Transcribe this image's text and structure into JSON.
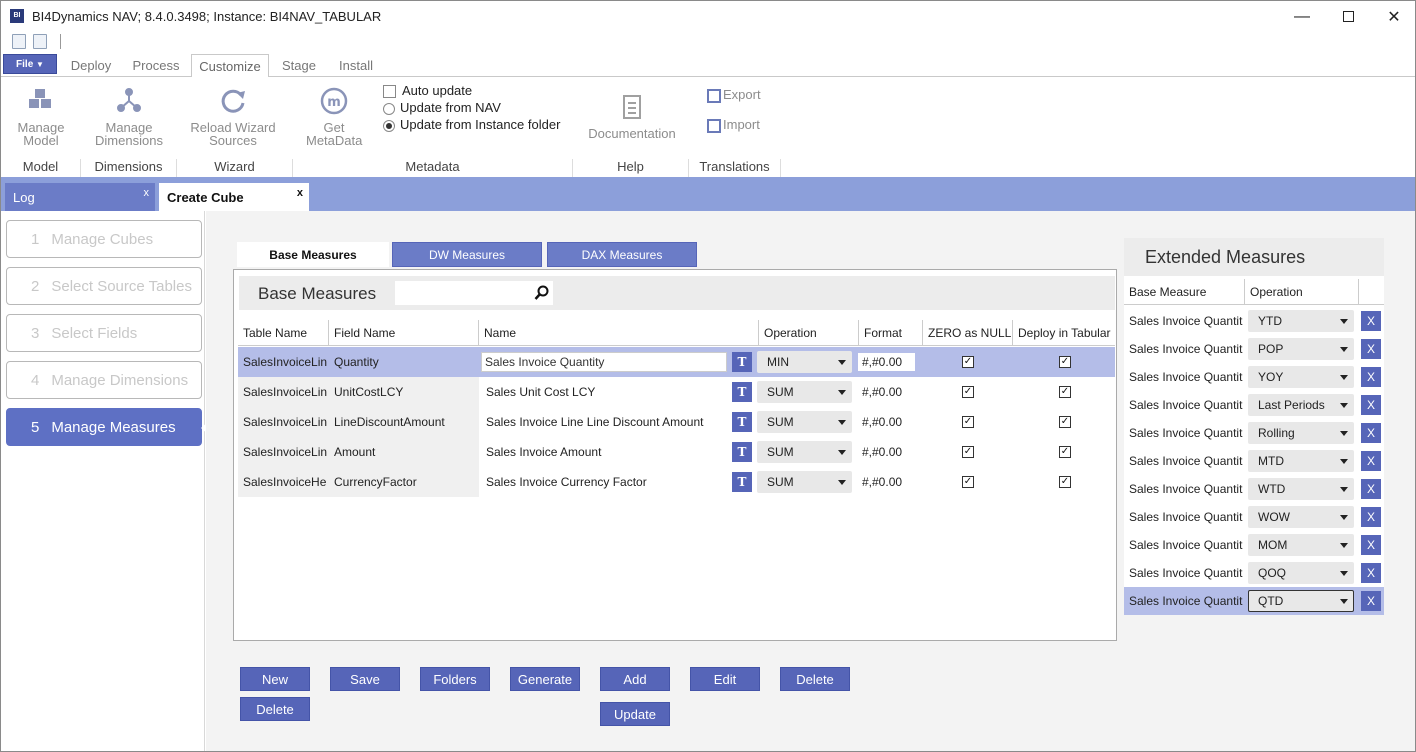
{
  "window": {
    "title": "BI4Dynamics NAV; 8.4.0.3498;  Instance: BI4NAV_TABULAR",
    "app_icon_text": "BI"
  },
  "ribbon_tabs": [
    {
      "label": "File"
    },
    {
      "label": "Deploy"
    },
    {
      "label": "Process"
    },
    {
      "label": "Customize"
    },
    {
      "label": "Stage"
    },
    {
      "label": "Install"
    }
  ],
  "ribbon": {
    "manage_model": "Manage Model",
    "manage_dimensions": "Manage Dimensions",
    "reload_wizard": "Reload Wizard Sources",
    "get_metadata": "Get MetaData",
    "auto_update": "Auto update",
    "update_from_nav": "Update from NAV",
    "update_from_instance": "Update from Instance folder",
    "documentation": "Documentation",
    "export": "Export",
    "import": "Import",
    "groups": [
      "Model",
      "Dimensions",
      "Wizard",
      "Metadata",
      "Help",
      "Translations"
    ]
  },
  "doc_tabs": [
    {
      "label": "Log"
    },
    {
      "label": "Create Cube"
    }
  ],
  "close_glyph": "x",
  "steps": [
    {
      "num": "1",
      "label": "Manage Cubes"
    },
    {
      "num": "2",
      "label": "Select Source Tables"
    },
    {
      "num": "3",
      "label": "Select Fields"
    },
    {
      "num": "4",
      "label": "Manage Dimensions"
    },
    {
      "num": "5",
      "label": "Manage Measures"
    }
  ],
  "inner_tabs": [
    "Base Measures",
    "DW Measures",
    "DAX Measures"
  ],
  "grid": {
    "title": "Base Measures",
    "columns": [
      "Table Name",
      "Field Name",
      "Name",
      "Operation",
      "Format",
      "ZERO as NULL",
      "Deploy in Tabular"
    ],
    "rows": [
      {
        "table": "SalesInvoiceLin",
        "field": "Quantity",
        "name": "Sales Invoice Quantity",
        "op": "MIN",
        "fmt": "#,#0.00"
      },
      {
        "table": "SalesInvoiceLin",
        "field": "UnitCostLCY",
        "name": "Sales Unit Cost LCY",
        "op": "SUM",
        "fmt": "#,#0.00"
      },
      {
        "table": "SalesInvoiceLin",
        "field": "LineDiscountAmount",
        "name": "Sales Invoice Line Line Discount Amount",
        "op": "SUM",
        "fmt": "#,#0.00"
      },
      {
        "table": "SalesInvoiceLin",
        "field": "Amount",
        "name": "Sales Invoice Amount",
        "op": "SUM",
        "fmt": "#,#0.00"
      },
      {
        "table": "SalesInvoiceHe",
        "field": "CurrencyFactor",
        "name": "Sales Invoice Currency Factor",
        "op": "SUM",
        "fmt": "#,#0.00"
      }
    ],
    "t_glyph": "T",
    "check_glyph": "✓"
  },
  "extended": {
    "title": "Extended Measures",
    "columns": [
      "Base Measure",
      "Operation"
    ],
    "rows": [
      {
        "base": "Sales Invoice Quantit",
        "op": "YTD"
      },
      {
        "base": "Sales Invoice Quantit",
        "op": "POP"
      },
      {
        "base": "Sales Invoice Quantit",
        "op": "YOY"
      },
      {
        "base": "Sales Invoice Quantit",
        "op": "Last Periods"
      },
      {
        "base": "Sales Invoice Quantit",
        "op": "Rolling"
      },
      {
        "base": "Sales Invoice Quantit",
        "op": "MTD"
      },
      {
        "base": "Sales Invoice Quantit",
        "op": "WTD"
      },
      {
        "base": "Sales Invoice Quantit",
        "op": "WOW"
      },
      {
        "base": "Sales Invoice Quantit",
        "op": "MOM"
      },
      {
        "base": "Sales Invoice Quantit",
        "op": "QOQ"
      },
      {
        "base": "Sales Invoice Quantit",
        "op": "QTD"
      }
    ],
    "x_glyph": "X"
  },
  "buttons": {
    "new": "New",
    "save": "Save",
    "folders": "Folders",
    "generate": "Generate",
    "add": "Add",
    "edit": "Edit",
    "delete": "Delete",
    "delete2": "Delete",
    "update": "Update"
  },
  "colors": {
    "accent": "#5665b8",
    "docbar": "#8c9fda",
    "selected_row": "#b4bde8"
  }
}
